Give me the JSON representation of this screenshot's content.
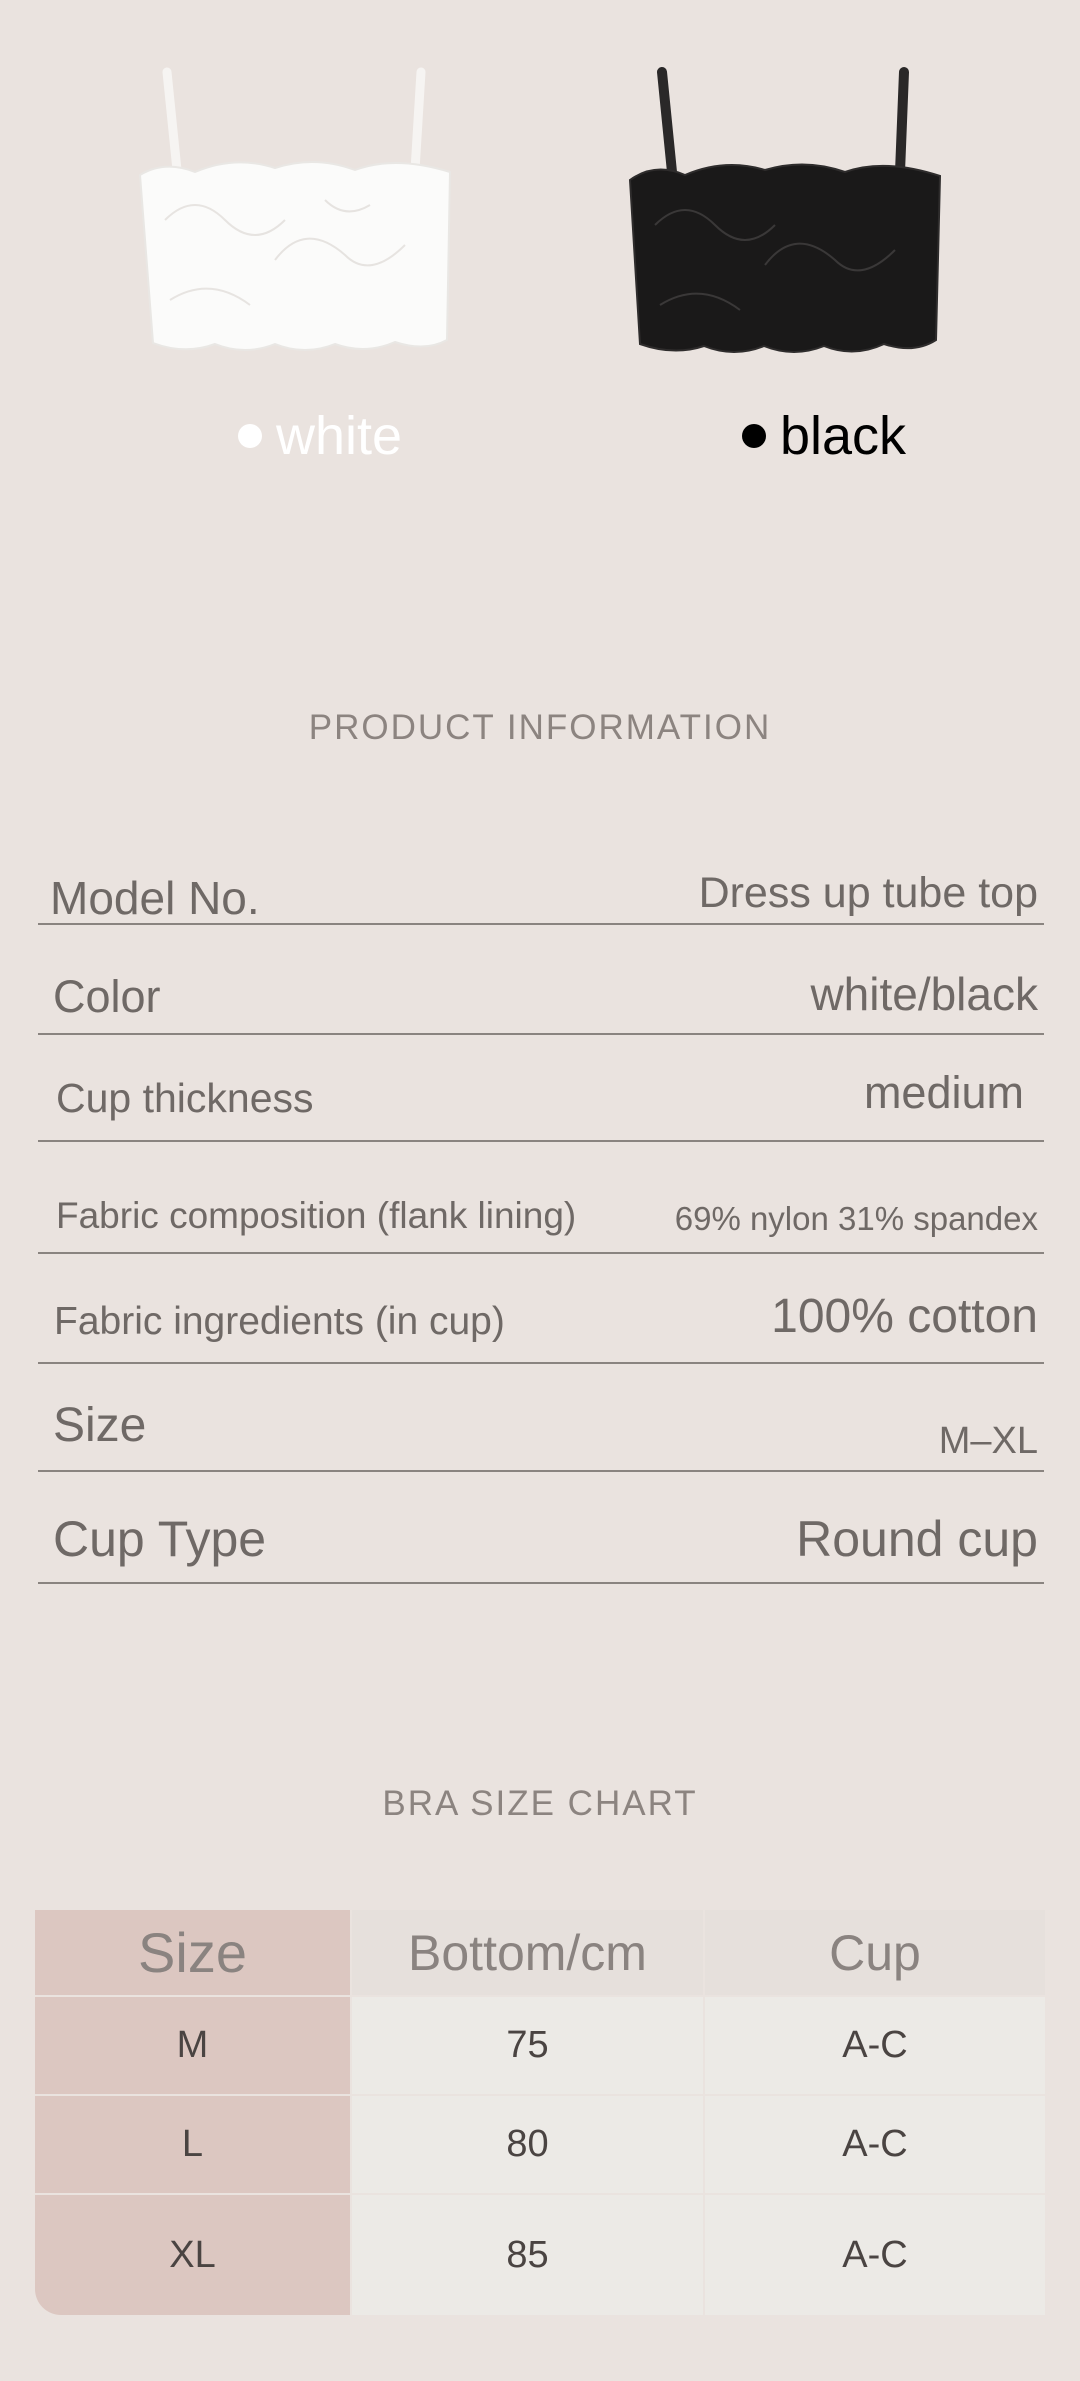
{
  "products": [
    {
      "id": "white",
      "label": "white",
      "color": "#ffffff"
    },
    {
      "id": "black",
      "label": "black",
      "color": "#000000"
    }
  ],
  "product_information": {
    "title": "PRODUCT INFORMATION",
    "rows": [
      {
        "key": "Model No.",
        "value": "Dress up tube top"
      },
      {
        "key": "Color",
        "value": "white/black"
      },
      {
        "key": "Cup thickness",
        "value": "medium"
      },
      {
        "key": "Fabric composition (flank lining)",
        "value": "69% nylon 31% spandex"
      },
      {
        "key": "Fabric ingredients (in cup)",
        "value": "100% cotton"
      },
      {
        "key": "Size",
        "value": "M–XL"
      },
      {
        "key": "Cup Type",
        "value": "Round cup"
      }
    ]
  },
  "size_chart": {
    "title": "BRA SIZE CHART",
    "headers": [
      "Size",
      "Bottom/cm",
      "Cup"
    ],
    "rows": [
      [
        "M",
        "75",
        "A-C"
      ],
      [
        "L",
        "80",
        "A-C"
      ],
      [
        "XL",
        "85",
        "A-C"
      ]
    ]
  },
  "colors": {
    "background": "#eae3df",
    "size_column": "#dcc7c1",
    "table_cell": "#eceae6",
    "text_muted": "#6f6966"
  }
}
